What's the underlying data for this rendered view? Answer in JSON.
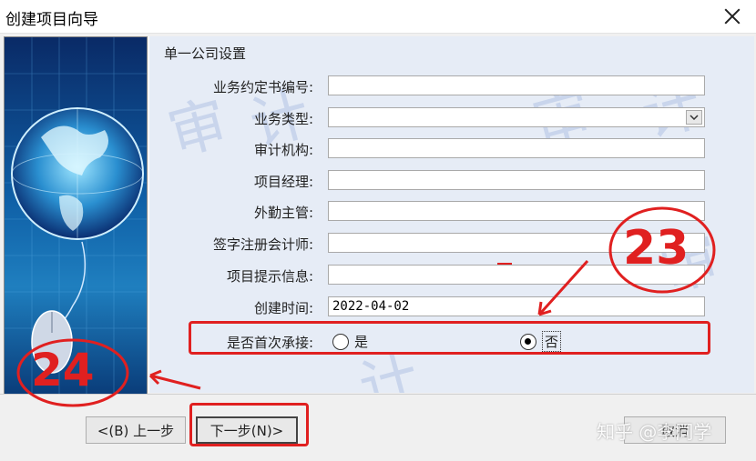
{
  "window": {
    "title": "创建项目向导"
  },
  "form": {
    "section_title": "单一公司设置",
    "fields": [
      {
        "label": "业务约定书编号:",
        "value": ""
      },
      {
        "label": "业务类型:",
        "value": ""
      },
      {
        "label": "审计机构:",
        "value": ""
      },
      {
        "label": "项目经理:",
        "value": ""
      },
      {
        "label": "外勤主管:",
        "value": ""
      },
      {
        "label": "签字注册会计师:",
        "value": ""
      },
      {
        "label": "项目提示信息:",
        "value": ""
      },
      {
        "label": "创建时间:",
        "value": "2022-04-02"
      }
    ],
    "first_engagement": {
      "label": "是否首次承接:",
      "options": [
        {
          "label": "是",
          "selected": false
        },
        {
          "label": "否",
          "selected": true
        }
      ]
    }
  },
  "buttons": {
    "back": "<(B) 上一步",
    "next": "下一步(N)>",
    "cancel": "取消"
  },
  "annotations": {
    "mark_23": "23",
    "mark_24": "24",
    "color": "#e02020"
  },
  "watermark": "知乎 @李同学",
  "icons": [
    "close-icon",
    "chevron-down-icon",
    "globe-mouse-illustration"
  ]
}
